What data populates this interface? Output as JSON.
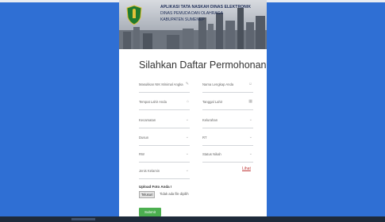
{
  "banner": {
    "title": "APLIKASI TATA NASKAH DINAS ELEKTRONIK",
    "subtitle1": "DINAS PEMUDA DAN OLAHRAGA",
    "subtitle2": "KABUPATEN SUMENEP"
  },
  "form": {
    "title": "Silahkan Daftar Permohonan",
    "fields": {
      "nik": "Masukkan NIK Minimal Angka",
      "nama": "Nama Lengkap Anda",
      "tempat_lahir": "Tempat Lahir Anda",
      "tanggal_lahir": "Tanggal Lahir",
      "kecamatan": "Kecamatan",
      "kelurahan": "Kelurahan",
      "dusun": "Dusun",
      "rt": "RT",
      "rw": "RW",
      "status_nikah": "Status Nikah",
      "jenis_kelamin": "Jenis Kelamin"
    },
    "foto_link": "Lihat",
    "upload_label": "Upload Foto Anda !",
    "upload_button": "Telusuri",
    "upload_status": "Tidak ada file dipilih",
    "submit_label": "Submit"
  },
  "colors": {
    "background": "#2f6fd4",
    "submit": "#4caf50",
    "link": "#c03a3a"
  }
}
